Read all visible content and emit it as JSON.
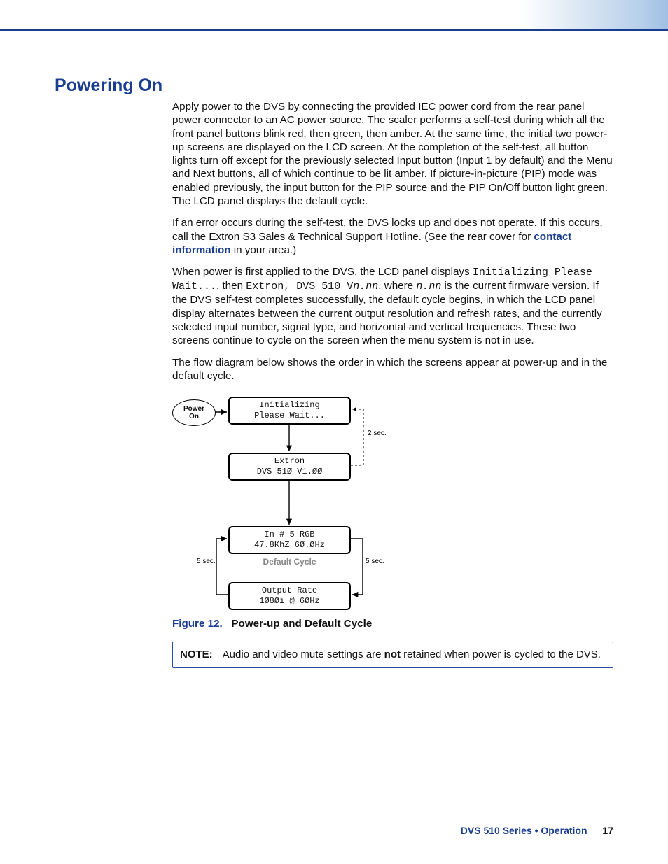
{
  "heading": "Powering On",
  "para1": "Apply power to the DVS by connecting the provided IEC power cord from the rear panel power connector to an AC power source. The scaler performs a self-test during which all the front panel buttons blink red, then green, then amber. At the same time, the initial two power-up screens are displayed on the LCD screen. At the completion of the self-test, all button lights turn off except for the previously selected Input button (Input 1 by default) and the Menu and Next buttons, all of which continue to be lit amber. If picture-in-picture (PIP) mode was enabled previously, the input button for the PIP source and the PIP On/Off button light green. The LCD panel displays the default cycle.",
  "para2_a": "If an error occurs during the self-test, the DVS locks up and does not operate. If this occurs, call the Extron S3 Sales & Technical Support Hotline. (See the rear cover for ",
  "para2_link": "contact information",
  "para2_b": " in your area.)",
  "para3_a": "When power is first applied to the DVS, the LCD panel displays ",
  "para3_m1": "Initializing Please Wait...",
  "para3_b": ", then ",
  "para3_m2": "Extron, DVS 510 V",
  "para3_m2i": "n.nn",
  "para3_c": ", where ",
  "para3_m3i": "n.nn",
  "para3_d": " is the current firmware version. If the DVS self-test completes successfully, the default cycle begins, in which the LCD panel display alternates between the current output resolution and refresh rates, and the currently selected input number, signal type, and horizontal and vertical frequencies. These two screens continue to cycle on the screen when the menu system is not in use.",
  "para4": "The flow diagram below shows the order in which the screens appear at power-up and in the default cycle.",
  "diagram": {
    "power_on_l1": "Power",
    "power_on_l2": "On",
    "init_l1": "Initializing",
    "init_l2": "Please Wait...",
    "extron_l1": "Extron",
    "extron_l2": "DVS 51Ø    V1.ØØ",
    "input_l1": "In # 5     RGB",
    "input_l2": "47.8KhZ   6Ø.ØHz",
    "output_l1": "Output Rate",
    "output_l2": "1Ø8Øi @ 6ØHz",
    "label_2sec": "2 sec.",
    "label_5sec_l": "5 sec.",
    "label_5sec_r": "5 sec.",
    "default_cycle": "Default Cycle"
  },
  "figure": {
    "number": "Figure 12.",
    "title": "Power-up and Default Cycle"
  },
  "note": {
    "label": "NOTE:",
    "text_a": "Audio and video mute settings are ",
    "text_bold": "not",
    "text_b": " retained when power is cycled to the DVS."
  },
  "footer": {
    "series": "DVS 510 Series • Operation",
    "page": "17"
  }
}
